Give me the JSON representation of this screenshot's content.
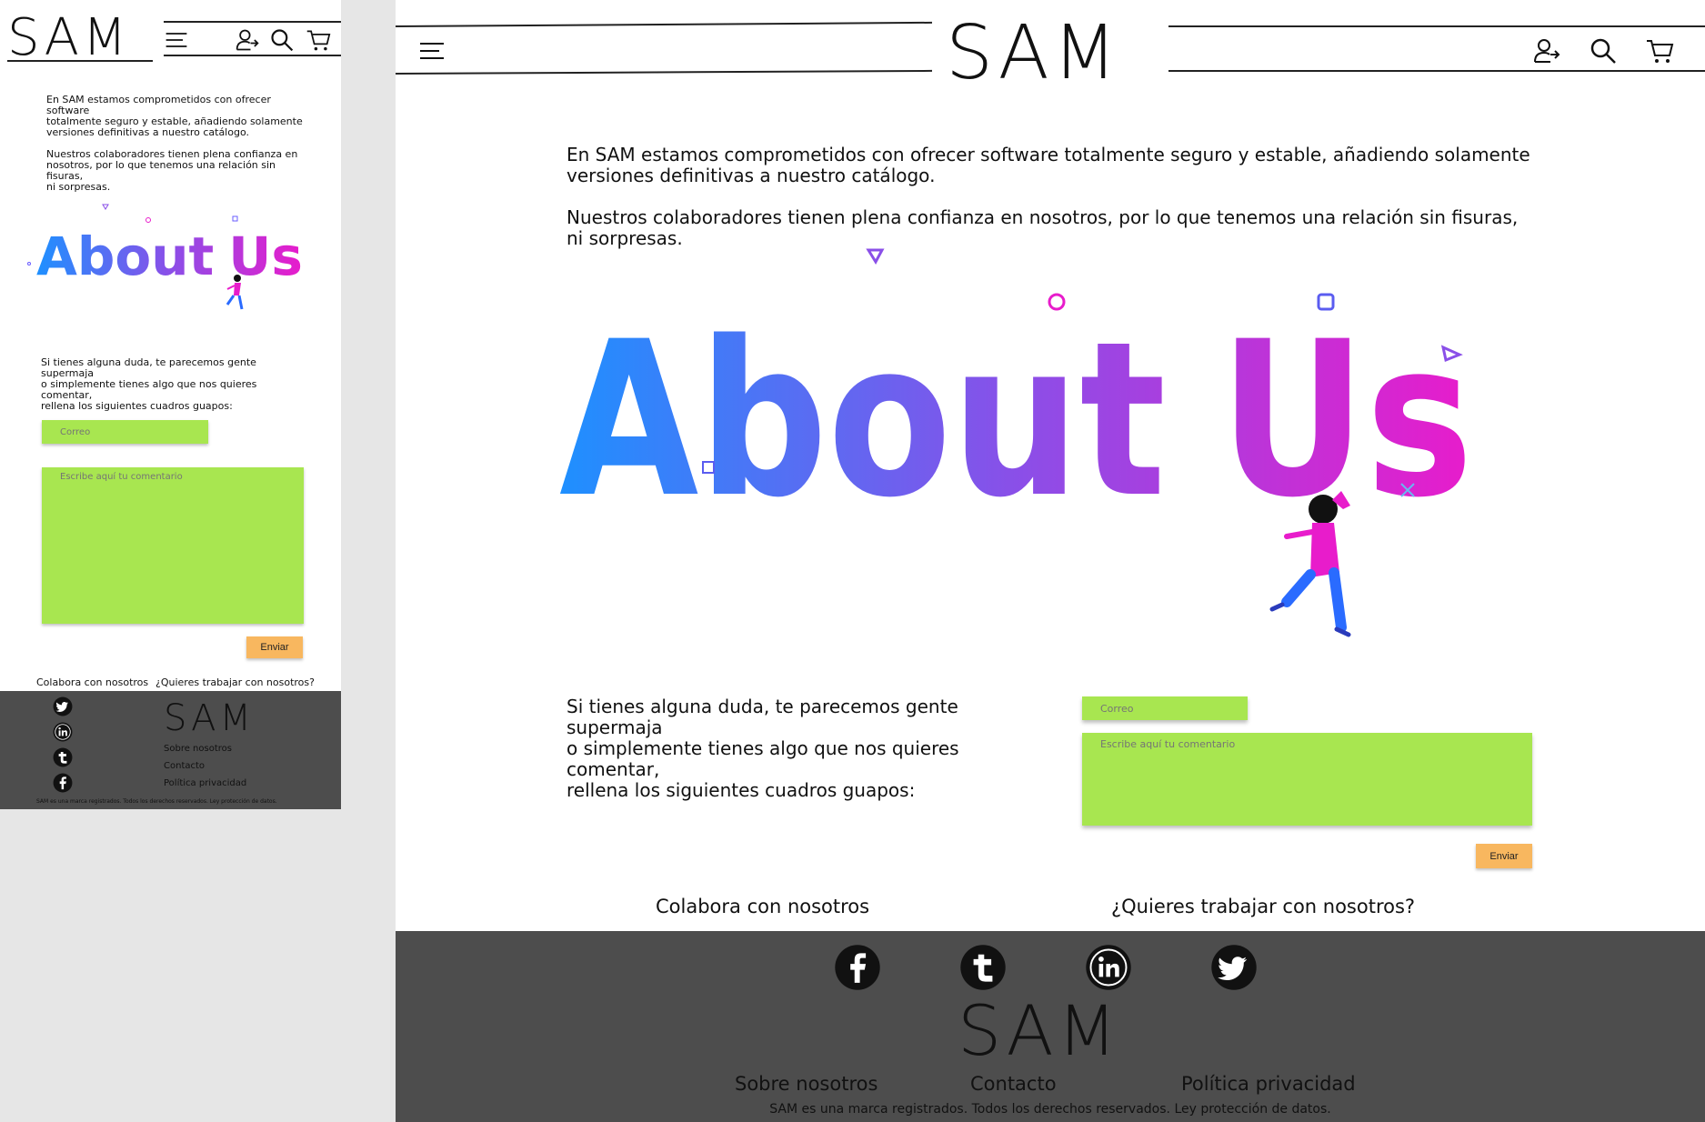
{
  "brand": {
    "logo": "SAM"
  },
  "intro": {
    "paragraph1": "En SAM estamos comprometidos con ofrecer software totalmente seguro y estable, añadiendo solamente versiones definitivas a nuestro catálogo.",
    "paragraph2": "Nuestros colaboradores tienen plena confianza en nosotros, por lo que tenemos una relación sin fisuras, ni sorpresas."
  },
  "mobile": {
    "intro_p1_lines": [
      "En SAM estamos comprometidos con ofrecer",
      "software",
      "totalmente seguro y estable, añadiendo solamente",
      "versiones definitivas a nuestro catálogo."
    ],
    "intro_p2_lines": [
      "Nuestros colaboradores tienen plena confianza en",
      "nosotros, por lo que tenemos una relación sin fisuras,",
      "ni sorpresas."
    ],
    "help_lines": [
      "Si tienes alguna duda, te parecemos gente",
      "supermaja",
      "o simplemente tienes algo que nos quieres comentar,",
      "rellena los siguientes cuadros guapos:"
    ]
  },
  "desktop": {
    "intro_p1_lines": [
      "En SAM estamos comprometidos con ofrecer software totalmente seguro y estable, añadiendo solamente",
      "versiones definitivas a nuestro catálogo."
    ],
    "intro_p2_lines": [
      "Nuestros colaboradores tienen plena confianza en nosotros, por lo que tenemos una relación sin fisuras,",
      "ni sorpresas."
    ],
    "help_lines": [
      "Si tienes alguna duda, te parecemos gente",
      "supermaja",
      "o simplemente tienes algo que nos quieres",
      "comentar,",
      "rellena los siguientes cuadros guapos:"
    ]
  },
  "hero": {
    "title_word1": "About",
    "title_word2": "Us"
  },
  "form": {
    "email_placeholder": "Correo",
    "comment_placeholder": "Escribe aquí tu comentario",
    "submit_label": "Enviar"
  },
  "cta": {
    "collaborate": "Colabora con nosotros",
    "work": "¿Quieres trabajar con nosotros?"
  },
  "footer": {
    "links": [
      "Sobre nosotros",
      "Contacto",
      "Política privacidad"
    ],
    "legal": "SAM es una marca registrados. Todos los derechos reservados. Ley protección de datos.",
    "social": [
      "facebook-icon",
      "tumblr-icon",
      "linkedin-icon",
      "twitter-icon"
    ]
  },
  "colors": {
    "field_green": "#a8e650",
    "button_orange": "#f8b75f",
    "footer_gray": "#4d4d4d",
    "gradient_start": "#1e90ff",
    "gradient_mid": "#8a4fe8",
    "gradient_end": "#e81ccb"
  }
}
